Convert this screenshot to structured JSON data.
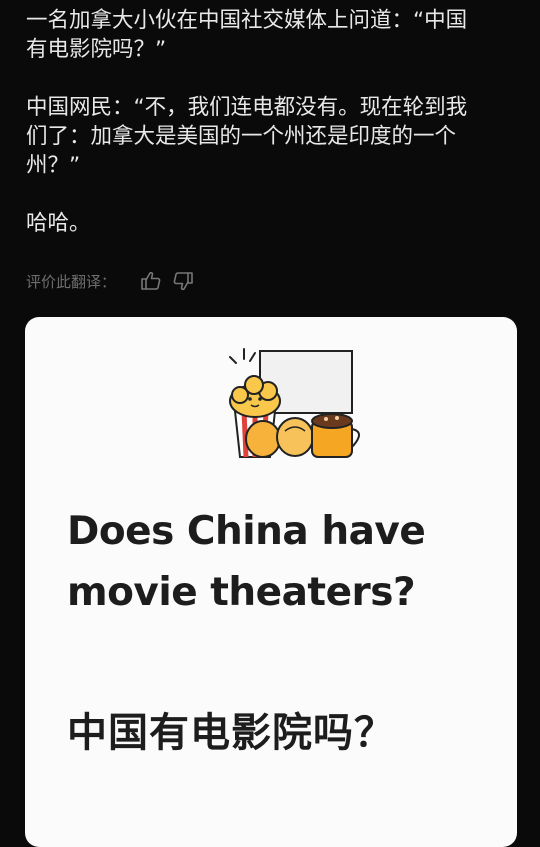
{
  "post": {
    "line1": "一名加拿大小伙在中国社交媒体上问道：“中国",
    "line2": "有电影院吗？”",
    "line3": "中国网民：“不，我们连电都没有。现在轮到我",
    "line4": "们了：加拿大是美国的一个州还是印度的一个",
    "line5": "州？”",
    "line6": "哈哈。"
  },
  "feedback": {
    "label": "评价此翻译：",
    "thumbs_up_icon": "thumbs-up-icon",
    "thumbs_down_icon": "thumbs-down-icon"
  },
  "card": {
    "english_line1": "Does China have",
    "english_line2": "movie theaters?",
    "chinese": "中国有电影院吗？",
    "illustration_icon": "popcorn-cinema-illustration"
  },
  "colors": {
    "background": "#0a0a0a",
    "text": "#e8e8e8",
    "muted": "#6e6e6e",
    "card": "#fbfbfb",
    "accent_orange": "#f5a623"
  }
}
